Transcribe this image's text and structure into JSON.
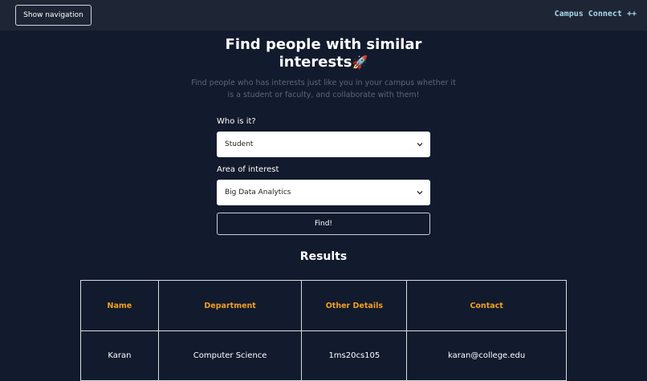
{
  "header": {
    "nav_button_label": "Show navigation",
    "brand": "Campus Connect ++"
  },
  "hero": {
    "title": "Find people with similar interests",
    "title_emoji": "🚀",
    "subtitle": "Find people who has interests just like you in your campus whether it is a student or faculty, and collaborate with them!"
  },
  "form": {
    "role_label": "Who is it?",
    "role_value": "Student",
    "interest_label": "Area of interest",
    "interest_value": "Big Data Analytics",
    "submit_label": "Find!"
  },
  "results": {
    "title": "Results",
    "columns": [
      "Name",
      "Department",
      "Other Details",
      "Contact"
    ],
    "rows": [
      [
        "Karan",
        "Computer Science",
        "1ms20cs105",
        "karan@college.edu"
      ]
    ]
  },
  "colors": {
    "background": "#121a2d",
    "topbar": "#1e2636",
    "brand": "#a6d8ea",
    "table_header": "#f0a020"
  }
}
